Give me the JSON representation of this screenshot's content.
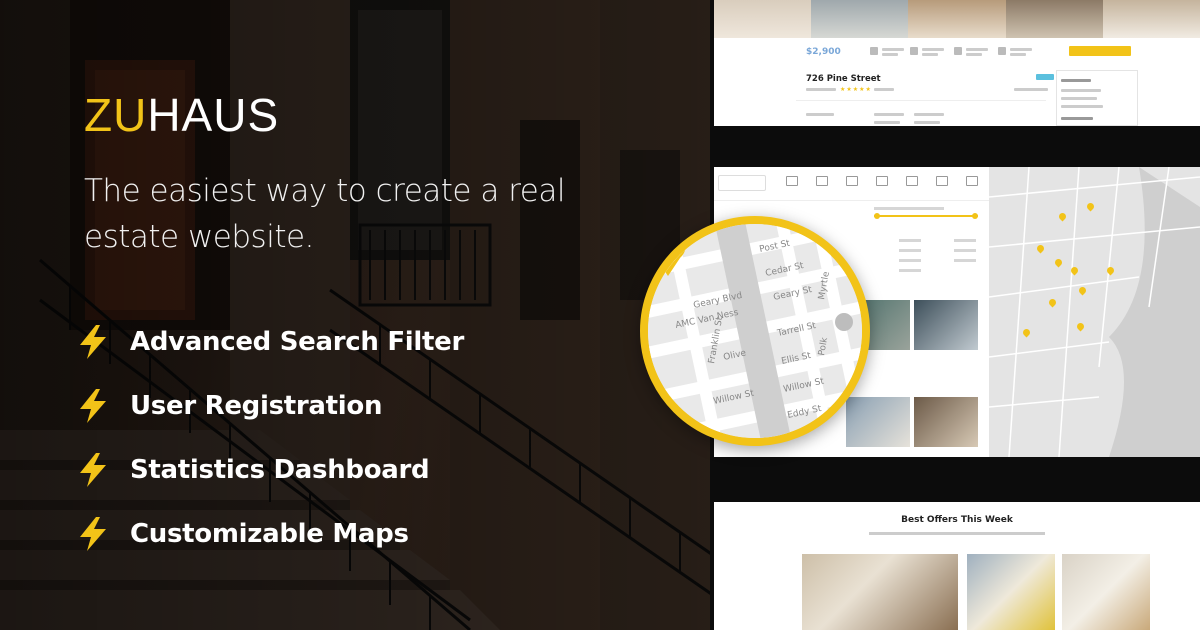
{
  "brand": {
    "prefix": "ZU",
    "suffix": "HAUS"
  },
  "tagline": "The easiest way to create a real estate website.",
  "features": [
    {
      "label": "Advanced Search Filter",
      "icon": "lightning-bolt-icon"
    },
    {
      "label": "User Registration",
      "icon": "lightning-bolt-icon"
    },
    {
      "label": "Statistics Dashboard",
      "icon": "lightning-bolt-icon"
    },
    {
      "label": "Customizable Maps",
      "icon": "lightning-bolt-icon"
    }
  ],
  "listing": {
    "price": "$2,900",
    "address": "726 Pine Street",
    "stars": "★★★★★"
  },
  "map_streets": [
    "Post St",
    "Cedar St",
    "Geary Blvd",
    "Geary St",
    "AMC Van Ness",
    "Myrtle",
    "Tarrell St",
    "Olive",
    "Ellis St",
    "Franklin St",
    "Polk",
    "Willow St",
    "Eddy St",
    "Willow St"
  ],
  "offers": {
    "heading": "Best Offers This Week"
  },
  "colors": {
    "accent": "#f2c318",
    "dark": "#0c0c0c",
    "text": "#ffffff"
  }
}
